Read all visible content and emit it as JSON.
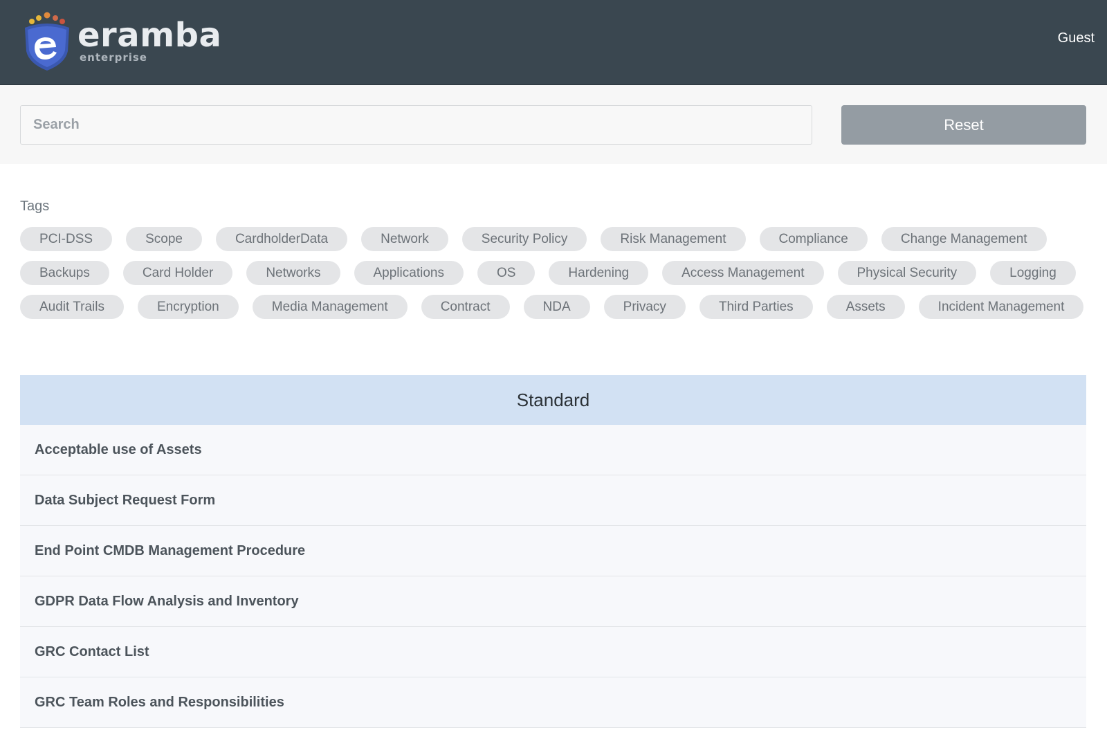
{
  "brand": {
    "name": "eramba",
    "edition": "enterprise"
  },
  "header": {
    "user": "Guest"
  },
  "search": {
    "placeholder": "Search",
    "value": "",
    "reset_label": "Reset"
  },
  "tags": {
    "heading": "Tags",
    "items": [
      "PCI-DSS",
      "Scope",
      "CardholderData",
      "Network",
      "Security Policy",
      "Risk Management",
      "Compliance",
      "Change Management",
      "Backups",
      "Card Holder",
      "Networks",
      "Applications",
      "OS",
      "Hardening",
      "Access Management",
      "Physical Security",
      "Logging",
      "Audit Trails",
      "Encryption",
      "Media Management",
      "Contract",
      "NDA",
      "Privacy",
      "Third Parties",
      "Assets",
      "Incident Management"
    ]
  },
  "standard": {
    "title": "Standard",
    "documents": [
      "Acceptable use of Assets",
      "Data Subject Request Form",
      "End Point CMDB Management Procedure",
      "GDPR Data Flow Analysis and Inventory",
      "GRC Contact List",
      "GRC Team Roles and Responsibilities"
    ]
  },
  "colors": {
    "topbar": "#3a4750",
    "panel_header": "#d2e1f3",
    "reset_button": "#949ca3",
    "tag_bg": "#e4e5e7"
  }
}
